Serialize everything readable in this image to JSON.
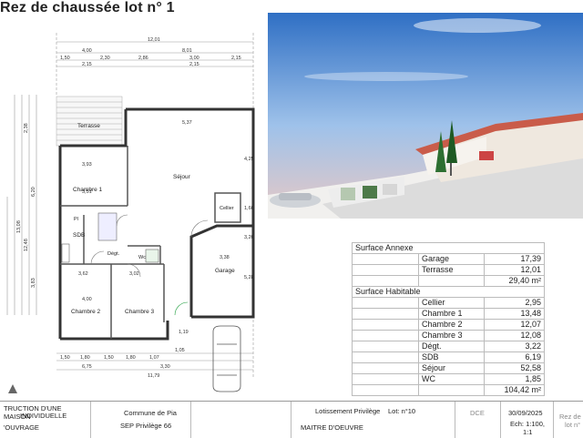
{
  "title": "Rez de chaussée lot n° 1",
  "plan": {
    "rooms": {
      "terrasse": "Terrasse",
      "sejour": "Séjour",
      "chambre1": "Chambre 1",
      "cellier": "Cellier",
      "pl": "Pl",
      "sdb": "SDB",
      "degt": "Dégt.",
      "wc": "Wc",
      "garage": "Garage",
      "chambre2": "Chambre 2",
      "chambre3": "Chambre 3"
    },
    "dims_top": {
      "overall": "12,01",
      "left": "4,00",
      "right": "8,01",
      "row2": [
        "1,50",
        "2,30",
        "2,86",
        "3,00",
        "2,15"
      ],
      "row3": [
        "2,15",
        "2,15"
      ]
    },
    "dims_inside": {
      "sejour_w": "5,37",
      "chambre1_w": "3,93",
      "sejour_h": "4,25",
      "garage_w": "3,38",
      "garage_h": "5,28",
      "ch2_w": "3,62",
      "ch3_w": "3,02",
      "ch2_h": "4,00",
      "ch1_h": "3,51",
      "v1": "3,20",
      "cellier_h": "1,60"
    },
    "dims_left": [
      "2,38",
      "6,20",
      "13,08",
      "12,48",
      "3,83"
    ],
    "dims_bottom": {
      "row1": [
        "1,50",
        "1,80",
        "1,50",
        "1,80",
        "1,07"
      ],
      "row2": [
        "6,75",
        "3,30"
      ],
      "overall": "11,79",
      "side": [
        "1,05",
        "1,19"
      ]
    }
  },
  "surface_annexe": {
    "header": "Surface Annexe",
    "rows": [
      {
        "label": "Garage",
        "value": "17,39"
      },
      {
        "label": "Terrasse",
        "value": "12,01"
      }
    ],
    "total": "29,40 m²"
  },
  "surface_habitable": {
    "header": "Surface Habitable",
    "rows": [
      {
        "label": "Cellier",
        "value": "2,95"
      },
      {
        "label": "Chambre 1",
        "value": "13,48"
      },
      {
        "label": "Chambre 2",
        "value": "12,07"
      },
      {
        "label": "Chambre 3",
        "value": "12,08"
      },
      {
        "label": "Dégt.",
        "value": "3,22"
      },
      {
        "label": "SDB",
        "value": "6,19"
      },
      {
        "label": "Séjour",
        "value": "52,58"
      },
      {
        "label": "WC",
        "value": "1,85"
      }
    ],
    "total": "104,42 m²"
  },
  "cartouche": {
    "projet_l1": "TRUCTION D'UNE MAISON",
    "projet_l2": "INDIVIDUELLE",
    "ouvrage": "'OUVRAGE",
    "commune": "Commune de Pia",
    "maitre_ouvrage": "SEP Privilège 66",
    "lotissement": "Lotissement Privilège",
    "lot": "Lot: n°10",
    "maitre_oeuvre": "MAITRE D'OEUVRE",
    "phase": "DCE",
    "date": "30/09/2025",
    "echelle": "Ech: 1:100,",
    "echelle2": "1:1",
    "plan_name": "Rez de",
    "plan_name2": "lot n°"
  }
}
